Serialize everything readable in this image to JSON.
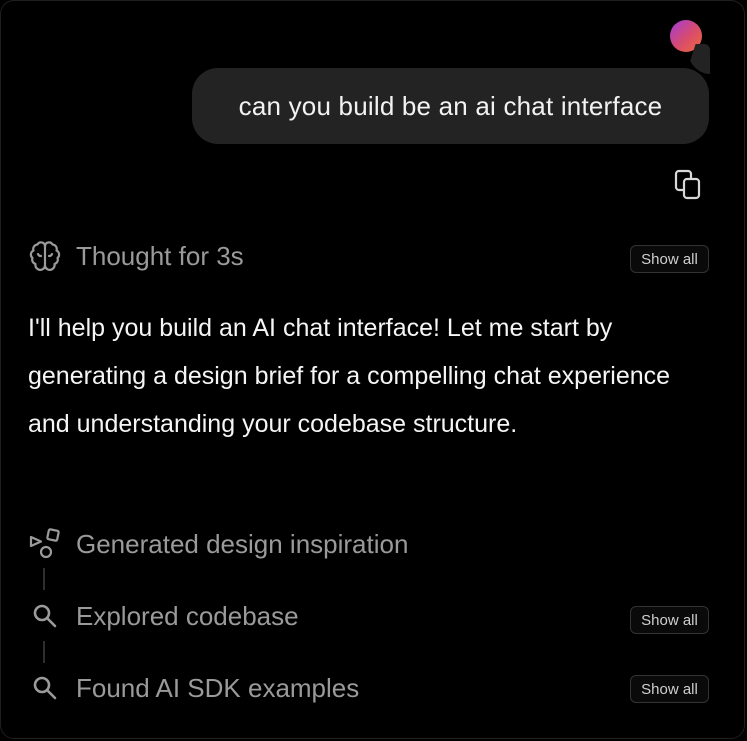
{
  "user_message": {
    "text": "can you build be an ai chat interface"
  },
  "thought": {
    "label": "Thought for 3s",
    "show_all_label": "Show all"
  },
  "assistant_message": {
    "text": "I'll help you build an AI chat interface! Let me start by generating a design brief for a compelling chat experience and understanding your codebase structure."
  },
  "steps": [
    {
      "label": "Generated design inspiration",
      "icon": "shapes-icon",
      "show_all_label": ""
    },
    {
      "label": "Explored codebase",
      "icon": "search-icon",
      "show_all_label": "Show all"
    },
    {
      "label": "Found AI SDK examples",
      "icon": "search-icon",
      "show_all_label": "Show all"
    }
  ],
  "colors": {
    "background": "#000000",
    "bubble": "#232323",
    "muted_text": "#9a9a9a",
    "primary_text": "#f5f5f5",
    "avatar_gradient": [
      "#a23bd9",
      "#ef6a3a"
    ]
  }
}
